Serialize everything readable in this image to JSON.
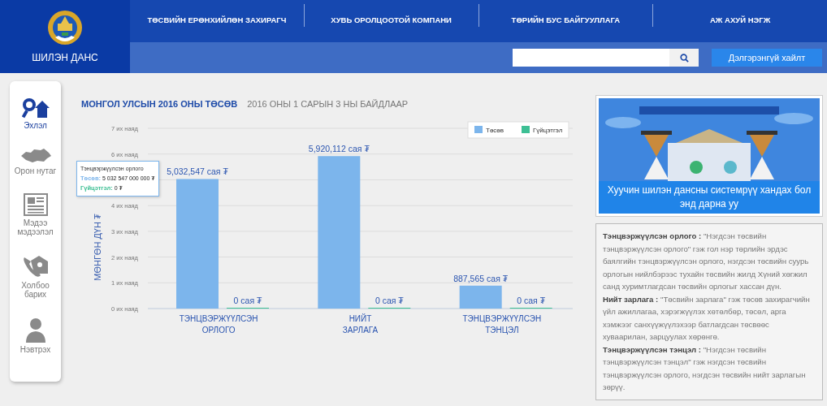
{
  "logo": {
    "title": "ШИЛЭН ДАНС"
  },
  "nav": [
    "ТӨСВИЙН ЕРӨНХИЙЛӨН ЗАХИРАГЧ",
    "ХУВЬ ОРОЛЦООТОЙ КОМПАНИ",
    "ТӨРИЙН БУС БАЙГУУЛЛАГА",
    "АЖ АХУЙ НЭГЖ"
  ],
  "search": {
    "button": "Дэлгэрэнгүй хайлт"
  },
  "sidebar": {
    "items": [
      {
        "kind": "home",
        "label": "Эхлэл",
        "selected": true
      },
      {
        "kind": "map",
        "label": "Орон нутаг",
        "selected": false
      },
      {
        "kind": "news",
        "label": "Мэдээ мэдээлэл",
        "selected": false
      },
      {
        "kind": "contact",
        "label": "Холбоо барих",
        "selected": false
      },
      {
        "kind": "user",
        "label": "Нэвтрэх",
        "selected": false
      }
    ]
  },
  "budget": {
    "title": "МОНГОЛ УЛСЫН 2016 ОНЫ ТӨСӨВ",
    "subtitle": "2016 ОНЫ 1 САРЫН 3 НЫ БАЙДЛААР",
    "chart_data": {
      "type": "bar",
      "ylabel": "МӨНГӨН ДҮН ₮",
      "categories": [
        "ТЭНЦВЭРЖҮҮЛСЭН ОРЛОГО",
        "НИЙТ ЗАРЛАГА",
        "ТЭНЦВЭРЖҮҮЛСЭН ТЭНЦЭЛ"
      ],
      "grid": true,
      "legend": "top-right",
      "series": [
        {
          "name": "Төсөв",
          "color": "#7cb5ec",
          "values": [
            5.03,
            5.92,
            0.89
          ]
        },
        {
          "name": "Гүйцэтгэл",
          "color": "#3dbf94",
          "values": [
            0,
            0,
            0
          ]
        }
      ],
      "ylim": [
        0,
        7
      ],
      "yticks": [
        {
          "value": 0,
          "label": "0 их наяд"
        },
        {
          "value": 1,
          "label": "1 их наяд"
        },
        {
          "value": 2,
          "label": "2 их наяд"
        },
        {
          "value": 3,
          "label": "3 их наяд"
        },
        {
          "value": 4,
          "label": "4 их наяд"
        },
        {
          "value": 6,
          "label": "6 их наяд"
        },
        {
          "value": 7,
          "label": "7 их наяд"
        }
      ]
    },
    "bar_labels": [
      [
        "5,032,547 сая ₮",
        "5,920,112 сая ₮",
        "887,565 сая ₮"
      ],
      [
        "0 сая ₮",
        "0 сая ₮",
        "0 сая ₮"
      ]
    ],
    "tooltip": {
      "title": "Тэнцвэржүүлсэн орлого",
      "rows": [
        {
          "label": "Төсөв:",
          "value": "5 032 547 000 000 ₮",
          "color": "#7cb5ec"
        },
        {
          "label": "Гүйцэтгэл:",
          "value": "0 ₮",
          "color": "#3dbf94"
        }
      ]
    }
  },
  "old_system": {
    "kind": "picture",
    "caption": "Хуучин шилэн дансны системрүү хандах бол энд дарна уу"
  },
  "definitions": [
    "**Тэнцвэржүүлсэн орлого :** \"Нэгдсэн төсвийн тэнцвэржүүлсэн орлого\" гэж гол нэр төрлийн эрдэс баялгийн тэнцвэржүүлсэн орлого, нэгдсэн төсвийн суурь орлогын нийлбэрээс тухайн төсвийн жилд Хүний хөгжил санд хуримтлагдсан төсвийн орлогыг хассан дүн.",
    "**Нийт зарлага :** \"Төсвийн зарлага\" гэж төсөв захирагчийн үйл ажиллагаа, хэрэгжүүлэх хөтөлбөр, төсөл, арга хэмжээг санхүүжүүлэхээр батлагдсан төсвөөс хуваарилан, зарцуулах хөрөнгө.",
    "**Тэнцвэржүүлсэн тэнцэл :** \"Нэгдсэн төсвийн тэнцвэржүүлсэн тэнцэл\" гэж нэгдсэн төсвийн тэнцвэржүүлсэн орлого, нэгдсэн төсвийн нийт зарлагын зөрүү."
  ]
}
